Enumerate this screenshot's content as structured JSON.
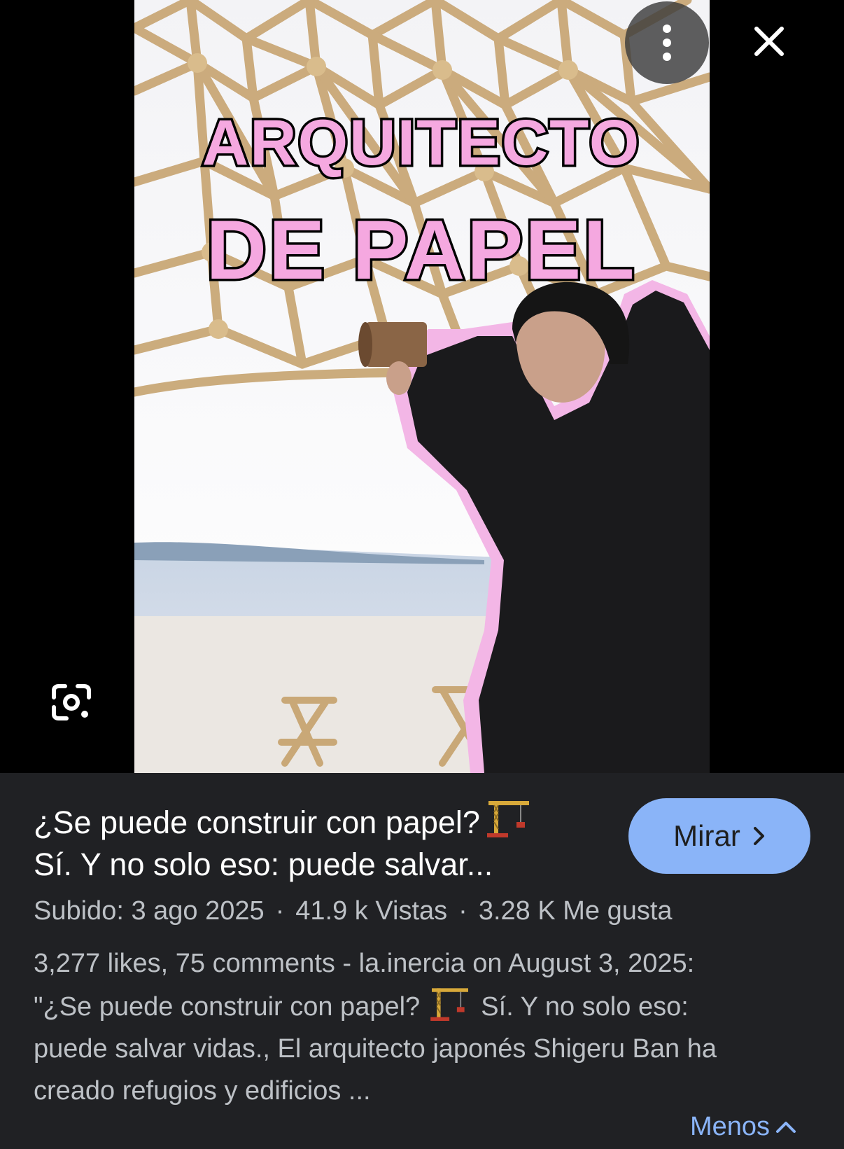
{
  "viewer": {
    "image_overlay_text": [
      "ARQUITECTO",
      "DE PAPEL"
    ],
    "more_icon": "more-vert-icon",
    "close_icon": "close-icon",
    "lens_icon": "google-lens-icon"
  },
  "result": {
    "title_line1": "¿Se puede construir con papel?",
    "title_line2": "Sí. Y no solo eso: puede salvar...",
    "title_emoji": "building-construction-crane-icon",
    "watch_button": "Mirar",
    "uploaded": "Subido: 3 ago 2025",
    "views": "41.9 k Vistas",
    "likes": "3.28 K Me gusta",
    "separator": "·",
    "description_line1": "3,277 likes, 75 comments - la.inercia on August 3, 2025:",
    "description_line2a": "\"¿Se puede construir con papel?",
    "description_line2b": "Sí. Y no solo eso:",
    "description_line3": "puede salvar vidas., El arquitecto japonés Shigeru Ban ha",
    "description_line4": "creado refugios y edificios ...",
    "less_link": "Menos"
  },
  "colors": {
    "panel_bg": "#202124",
    "accent": "#8ab4f8",
    "overlay_pink": "#f5a8e0"
  }
}
